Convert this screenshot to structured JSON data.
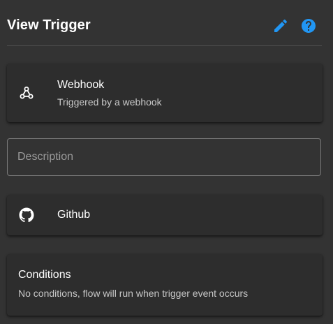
{
  "header": {
    "title": "View Trigger",
    "accent_color": "#2196f3",
    "edit_icon": "pencil-icon",
    "help_icon": "help-circle-icon"
  },
  "webhook_card": {
    "icon": "webhook-icon",
    "title": "Webhook",
    "subtitle": "Triggered by a webhook"
  },
  "description": {
    "placeholder": "Description",
    "value": ""
  },
  "github_card": {
    "icon": "github-icon",
    "title": "Github"
  },
  "conditions_card": {
    "title": "Conditions",
    "text": "No conditions, flow will run when trigger event occurs"
  }
}
